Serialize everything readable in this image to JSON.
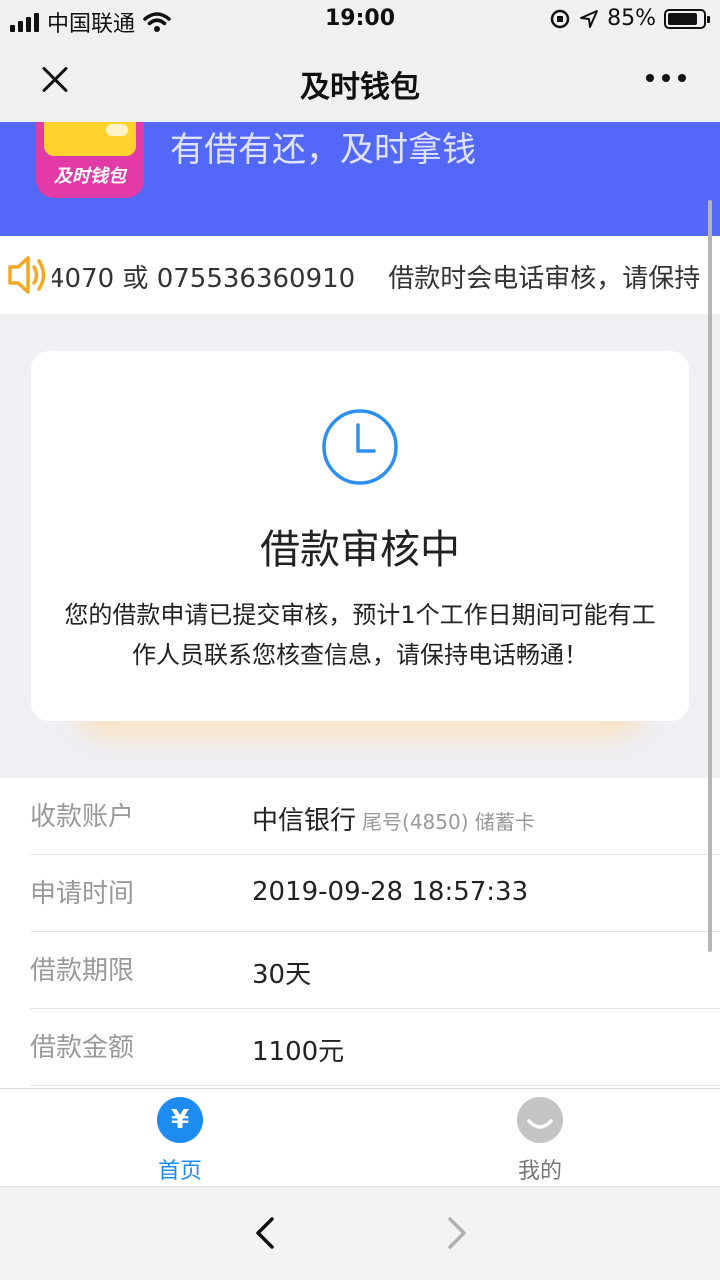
{
  "status_bar": {
    "carrier": "中国联通",
    "time": "19:00",
    "battery": "85%",
    "battery_level": 0.85
  },
  "nav": {
    "title": "及时钱包"
  },
  "banner": {
    "logo_text": "及时钱包",
    "slogan": "有借有还，及时拿钱"
  },
  "notice": {
    "text": "4070 或 075536360910    借款时会电话审核，请保持"
  },
  "status_card": {
    "title": "借款审核中",
    "description": "您的借款申请已提交审核，预计1个工作日期间可能有工作人员联系您核查信息，请保持电话畅通！"
  },
  "details": {
    "rows": [
      {
        "label": "收款账户",
        "value": "中信银行",
        "sub": "尾号(4850) 储蓄卡"
      },
      {
        "label": "申请时间",
        "value": "2019-09-28 18:57:33",
        "sub": ""
      },
      {
        "label": "借款期限",
        "value": "30天",
        "sub": ""
      },
      {
        "label": "借款金额",
        "value": "1100元",
        "sub": ""
      }
    ]
  },
  "tabbar": {
    "home_icon": "¥",
    "home_label": "首页",
    "mine_label": "我的"
  },
  "colors": {
    "brand_blue": "#5468f7",
    "accent_blue": "#1d8cf0",
    "speaker_orange": "#f5a623"
  }
}
